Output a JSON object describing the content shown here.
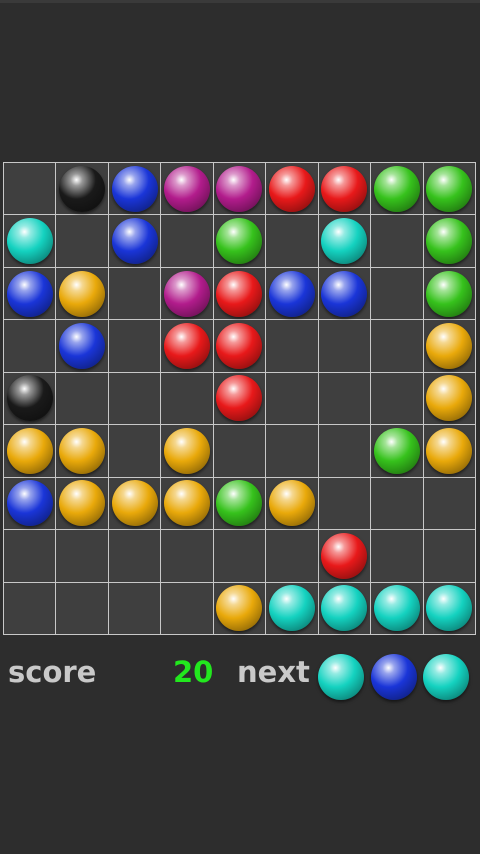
{
  "game": {
    "grid_size": 9,
    "board": [
      [
        "",
        "black",
        "blue",
        "magenta",
        "magenta",
        "red",
        "red",
        "green",
        "green"
      ],
      [
        "cyan",
        "",
        "blue",
        "",
        "green",
        "",
        "cyan",
        "",
        "green"
      ],
      [
        "blue",
        "yellow",
        "",
        "magenta",
        "red",
        "blue",
        "blue",
        "",
        "green"
      ],
      [
        "",
        "blue",
        "",
        "red",
        "red",
        "",
        "",
        "",
        "yellow"
      ],
      [
        "black",
        "",
        "",
        "",
        "red",
        "",
        "",
        "",
        "yellow"
      ],
      [
        "yellow",
        "yellow",
        "",
        "yellow",
        "",
        "",
        "",
        "green",
        "yellow"
      ],
      [
        "blue",
        "yellow",
        "yellow",
        "yellow",
        "green",
        "yellow",
        "",
        "",
        ""
      ],
      [
        "",
        "",
        "",
        "",
        "",
        "",
        "red",
        "",
        ""
      ],
      [
        "",
        "",
        "",
        "",
        "yellow",
        "cyan",
        "cyan",
        "cyan",
        "cyan"
      ]
    ]
  },
  "footer": {
    "score_label": "score",
    "score_value": "20",
    "next_label": "next",
    "next_balls": [
      "cyan",
      "blue",
      "cyan"
    ]
  },
  "colors": {
    "red": "#e8191a",
    "blue": "#1a35d8",
    "green": "#36c21c",
    "yellow": "#e9a90a",
    "cyan": "#14d2c0",
    "magenta": "#b21c8c",
    "black": "#1a1a1a",
    "score_green": "#22e81e",
    "cell_bg": "#3f3f3f",
    "grid_line": "#c8c8c8",
    "background": "#2d2d2d"
  }
}
